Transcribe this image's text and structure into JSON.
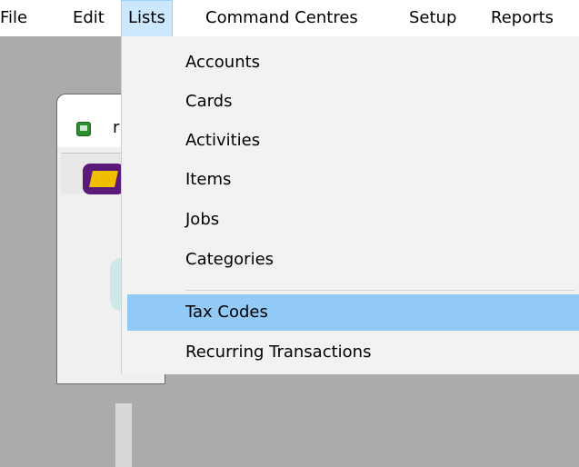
{
  "menubar": {
    "items": [
      {
        "label": "File"
      },
      {
        "label": "Edit"
      },
      {
        "label": "Lists"
      },
      {
        "label": "Command Centres"
      },
      {
        "label": "Setup"
      },
      {
        "label": "Reports"
      }
    ]
  },
  "background_window": {
    "title_fragment": "r"
  },
  "lists_menu": {
    "items": [
      {
        "label": "Accounts"
      },
      {
        "label": "Cards"
      },
      {
        "label": "Activities"
      },
      {
        "label": "Items"
      },
      {
        "label": "Jobs"
      },
      {
        "label": "Categories"
      },
      {
        "label": "Tax Codes"
      },
      {
        "label": "Recurring Transactions"
      }
    ],
    "highlighted": "Tax Codes"
  },
  "colors": {
    "highlight": "#91c9f7",
    "active_menu": "#cce8ff",
    "menu_background": "#f2f2f2",
    "desktop": "#ababab"
  }
}
